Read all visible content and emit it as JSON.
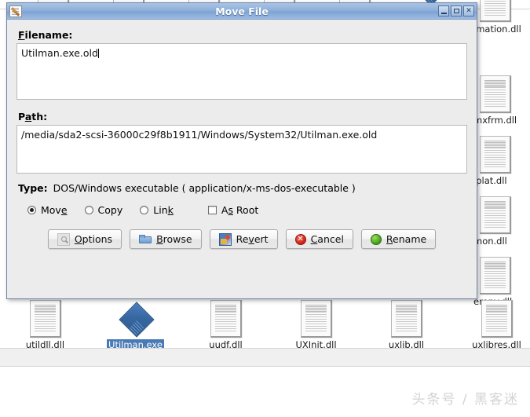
{
  "dialog": {
    "title": "Move File",
    "title_icon": "document-pencil-icon",
    "window_buttons": {
      "minimize": "minimize-icon",
      "maximize": "maximize-icon",
      "close": "✕"
    },
    "filename": {
      "label_pre": "F",
      "label_post": "ilename:",
      "value": "Utilman.exe.old"
    },
    "path": {
      "label_pre": "P",
      "label_mid": "a",
      "label_post": "th:",
      "value": "/media/sda2-scsi-36000c29f8b1911/Windows/System32/Utilman.exe.old"
    },
    "type": {
      "key": "Type:",
      "value": "DOS/Windows executable ( application/x-ms-dos-executable )"
    },
    "options": [
      {
        "name": "move",
        "label_pre": "Mov",
        "label_mnemonic": "e",
        "label_post": "",
        "kind": "radio",
        "checked": true
      },
      {
        "name": "copy",
        "label_pre": "Copy",
        "label_mnemonic": "",
        "label_post": "",
        "kind": "radio",
        "checked": false
      },
      {
        "name": "link",
        "label_pre": "Lin",
        "label_mnemonic": "k",
        "label_post": "",
        "kind": "radio",
        "checked": false
      },
      {
        "name": "as-root",
        "label_pre": "A",
        "label_mnemonic": "s",
        "label_post": " Root",
        "kind": "checkbox",
        "checked": false
      }
    ],
    "buttons": [
      {
        "name": "options",
        "icon": "options-icon",
        "pre": "",
        "mnemonic": "O",
        "post": "ptions"
      },
      {
        "name": "browse",
        "icon": "folder-icon",
        "pre": "",
        "mnemonic": "B",
        "post": "rowse"
      },
      {
        "name": "revert",
        "icon": "revert-icon",
        "pre": "Re",
        "mnemonic": "v",
        "post": "ert"
      },
      {
        "name": "cancel",
        "icon": "cancel-icon",
        "pre": "",
        "mnemonic": "C",
        "post": "ancel"
      },
      {
        "name": "rename",
        "icon": "rename-icon",
        "pre": "",
        "mnemonic": "R",
        "post": "ename"
      }
    ]
  },
  "filemanager": {
    "bottom_row": [
      {
        "name": "utildll.dll",
        "label": "utildll.dll",
        "icon": "document-icon",
        "selected": false
      },
      {
        "name": "Utilman.exe",
        "label": "Utilman.exe",
        "icon": "diamond-icon",
        "selected": true
      },
      {
        "name": "uudf.dll",
        "label": "uudf.dll",
        "icon": "document-icon",
        "selected": false
      },
      {
        "name": "UXInit.dll",
        "label": "UXInit.dll",
        "icon": "document-icon",
        "selected": false
      },
      {
        "name": "uxlib.dll",
        "label": "uxlib.dll",
        "icon": "document-icon",
        "selected": false
      },
      {
        "name": "uxlibres.dll",
        "label": "uxlibres.dll",
        "icon": "document-icon",
        "selected": false
      }
    ],
    "right_column": [
      {
        "name": "imation.dll",
        "label": "imation.dll",
        "icon": "document-icon"
      },
      {
        "name": "mxfrm.dll",
        "label": "mxfrm.dll",
        "icon": "document-icon"
      },
      {
        "name": "iplat.dll",
        "label": "iplat.dll",
        "icon": "document-icon"
      },
      {
        "name": "mon.dll",
        "label": "mon.dll",
        "icon": "document-icon"
      },
      {
        "name": "erenv.dll",
        "label": "erenv.dll",
        "icon": "document-icon"
      }
    ]
  },
  "watermark": {
    "text": "头条号 / 黑客迷"
  },
  "colors": {
    "titlebar": "#8fb0da",
    "selection": "#4a7ab5",
    "dialog_bg": "#ececec",
    "cancel": "#c91f14",
    "rename": "#3e9b16"
  }
}
